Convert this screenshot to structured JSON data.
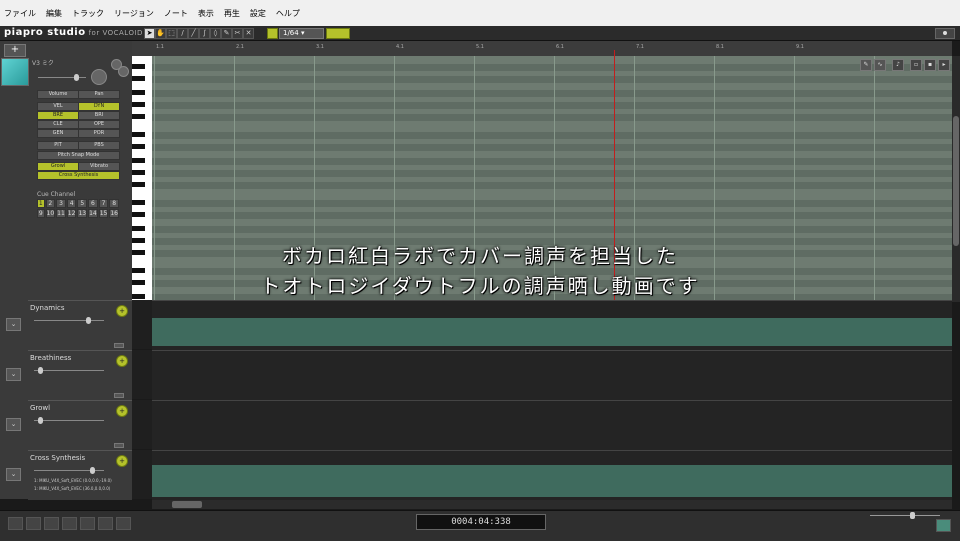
{
  "menu": [
    "ファイル",
    "編集",
    "トラック",
    "リージョン",
    "ノート",
    "表示",
    "再生",
    "設定",
    "ヘルプ"
  ],
  "app": {
    "logo": "piapro studio",
    "logo_sub": "for VOCALOID"
  },
  "toolbar": {
    "quantize": "1/64"
  },
  "singer": {
    "name": "V3 ミク"
  },
  "params": {
    "volume": "Volume",
    "pan": "Pan",
    "rows": [
      [
        "VEL",
        "DYN"
      ],
      [
        "BRE",
        "BRI"
      ],
      [
        "CLE",
        "OPE"
      ],
      [
        "GEN",
        "POR"
      ],
      [
        "PIT",
        "PBS"
      ]
    ],
    "pitch_snap": "Pitch Snap Mode",
    "growl": "Growl",
    "vibrato": "Vibrato",
    "cross": "Cross Synthesis"
  },
  "cs": {
    "label": "Cue Channel",
    "nums": [
      "1",
      "2",
      "3",
      "4",
      "5",
      "6",
      "7",
      "8",
      "9",
      "10",
      "11",
      "12",
      "13",
      "14",
      "15",
      "16"
    ]
  },
  "ruler": [
    "1.1",
    "2.1",
    "3.1",
    "4.1",
    "5.1",
    "6.1",
    "7.1",
    "8.1",
    "9.1"
  ],
  "lanes": [
    {
      "name": "Dynamics"
    },
    {
      "name": "Breathiness"
    },
    {
      "name": "Growl"
    },
    {
      "name": "Cross Synthesis"
    }
  ],
  "cross_lines": [
    "1: MIKU_V4X_Soft_EVEC (0.0,0.0,-19.0)",
    "1: MIKU_V4X_Soft_EVEC (36.0,0.0,0.0)"
  ],
  "timer": "0004:04:338",
  "subtitles": [
    "ボカロ紅白ラボでカバー調声を担当した",
    "トオトロジイダウトフルの調声晒し動画です"
  ]
}
